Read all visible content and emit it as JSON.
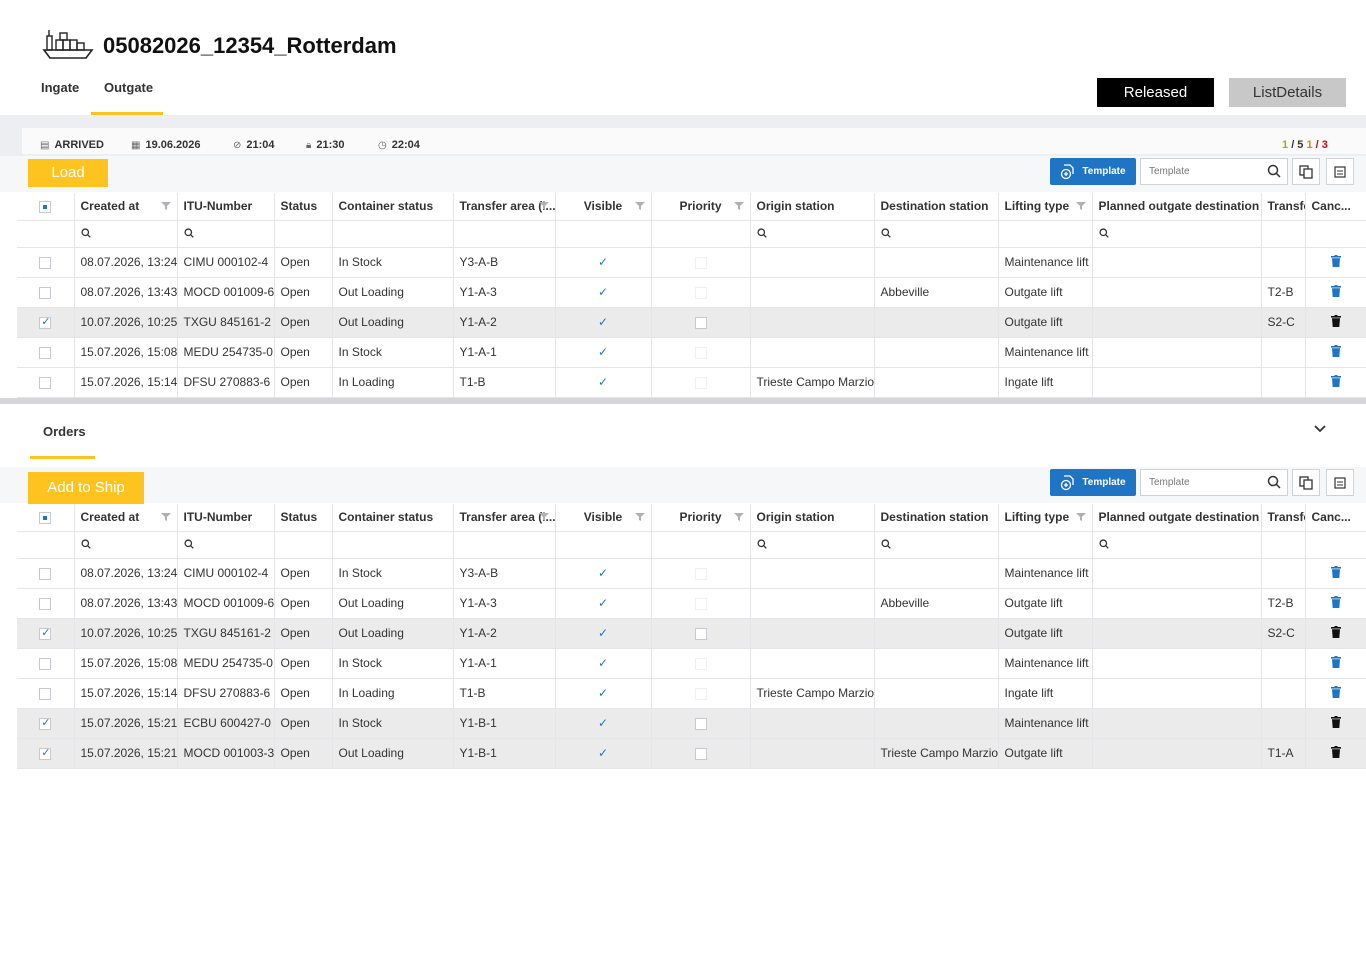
{
  "header": {
    "title": "05082026_12354_Rotterdam",
    "tabs": [
      {
        "label": "Ingate"
      },
      {
        "label": "Outgate"
      }
    ],
    "released_label": "Released",
    "listdetails_label": "ListDetails"
  },
  "info": {
    "status": "ARRIVED",
    "date": "19.06.2026",
    "time1": "21:04",
    "time2": "21:30",
    "time3": "22:04",
    "counter_a": "1",
    "counter_a_total": "/ 5",
    "counter_b": "1",
    "counter_b_total": "/ 3"
  },
  "load_section": {
    "button_label": "Load",
    "template_button": "Template",
    "template_placeholder": "Template"
  },
  "orders_section": {
    "label": "Orders",
    "button_label": "Add to Ship",
    "template_button": "Template",
    "template_placeholder": "Template"
  },
  "columns": [
    "Created at",
    "ITU-Number",
    "Status",
    "Container status",
    "Transfer area (I...",
    "Visible",
    "Priority",
    "Origin station",
    "Destination station",
    "Lifting type",
    "Planned outgate destination",
    "Transfe",
    "Canc..."
  ],
  "load_rows": [
    {
      "created": "08.07.2026, 13:24",
      "itu": "CIMU 000102-4",
      "status": "Open",
      "container": "In Stock",
      "area": "Y3-A-B",
      "origin": "",
      "destination": "",
      "lifting": "Maintenance lift",
      "planned": "",
      "transfer": "",
      "selected": false
    },
    {
      "created": "08.07.2026, 13:43",
      "itu": "MOCD 001009-6",
      "status": "Open",
      "container": "Out Loading",
      "area": "Y1-A-3",
      "origin": "",
      "destination": "Abbeville",
      "lifting": "Outgate lift",
      "planned": "",
      "transfer": "T2-B",
      "selected": false
    },
    {
      "created": "10.07.2026, 10:25",
      "itu": "TXGU 845161-2",
      "status": "Open",
      "container": "Out Loading",
      "area": "Y1-A-2",
      "origin": "",
      "destination": "",
      "lifting": "Outgate lift",
      "planned": "",
      "transfer": "S2-C",
      "selected": true
    },
    {
      "created": "15.07.2026, 15:08",
      "itu": "MEDU 254735-0",
      "status": "Open",
      "container": "In Stock",
      "area": "Y1-A-1",
      "origin": "",
      "destination": "",
      "lifting": "Maintenance lift",
      "planned": "",
      "transfer": "",
      "selected": false
    },
    {
      "created": "15.07.2026, 15:14",
      "itu": "DFSU 270883-6",
      "status": "Open",
      "container": "In Loading",
      "area": "T1-B",
      "origin": "Trieste Campo Marzio",
      "destination": "",
      "lifting": "Ingate lift",
      "planned": "",
      "transfer": "",
      "selected": false
    }
  ],
  "order_rows": [
    {
      "created": "08.07.2026, 13:24",
      "itu": "CIMU 000102-4",
      "status": "Open",
      "container": "In Stock",
      "area": "Y3-A-B",
      "origin": "",
      "destination": "",
      "lifting": "Maintenance lift",
      "planned": "",
      "transfer": "",
      "selected": false
    },
    {
      "created": "08.07.2026, 13:43",
      "itu": "MOCD 001009-6",
      "status": "Open",
      "container": "Out Loading",
      "area": "Y1-A-3",
      "origin": "",
      "destination": "Abbeville",
      "lifting": "Outgate lift",
      "planned": "",
      "transfer": "T2-B",
      "selected": false
    },
    {
      "created": "10.07.2026, 10:25",
      "itu": "TXGU 845161-2",
      "status": "Open",
      "container": "Out Loading",
      "area": "Y1-A-2",
      "origin": "",
      "destination": "",
      "lifting": "Outgate lift",
      "planned": "",
      "transfer": "S2-C",
      "selected": true
    },
    {
      "created": "15.07.2026, 15:08",
      "itu": "MEDU 254735-0",
      "status": "Open",
      "container": "In Stock",
      "area": "Y1-A-1",
      "origin": "",
      "destination": "",
      "lifting": "Maintenance lift",
      "planned": "",
      "transfer": "",
      "selected": false
    },
    {
      "created": "15.07.2026, 15:14",
      "itu": "DFSU 270883-6",
      "status": "Open",
      "container": "In Loading",
      "area": "T1-B",
      "origin": "Trieste Campo Marzio",
      "destination": "",
      "lifting": "Ingate lift",
      "planned": "",
      "transfer": "",
      "selected": false
    },
    {
      "created": "15.07.2026, 15:21",
      "itu": "ECBU 600427-0",
      "status": "Open",
      "container": "In Stock",
      "area": "Y1-B-1",
      "origin": "",
      "destination": "",
      "lifting": "Maintenance lift",
      "planned": "",
      "transfer": "",
      "selected": true
    },
    {
      "created": "15.07.2026, 15:21",
      "itu": "MOCD 001003-3",
      "status": "Open",
      "container": "Out Loading",
      "area": "Y1-B-1",
      "origin": "",
      "destination": "Trieste Campo Marzio",
      "lifting": "Outgate lift",
      "planned": "",
      "transfer": "T1-A",
      "selected": true
    }
  ],
  "colors": {
    "accent": "#ffc31f",
    "primary": "#1f75c4",
    "released_bg": "#000000",
    "selected_row": "#ebebeb"
  }
}
